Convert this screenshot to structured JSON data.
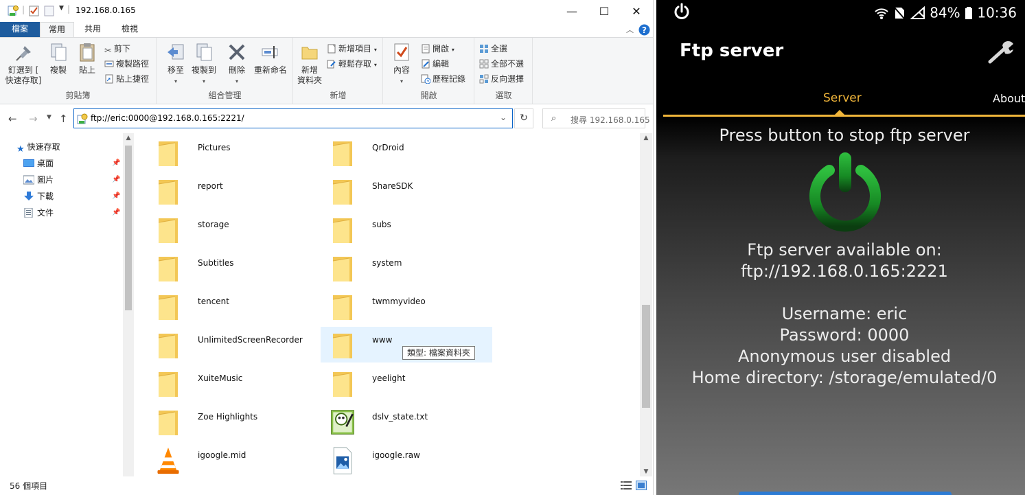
{
  "explorer": {
    "window_title": "192.168.0.165",
    "controls": {
      "minimize": "—",
      "maximize": "☐",
      "close": "✕"
    },
    "tabs": {
      "file": "檔案",
      "home": "常用",
      "share": "共用",
      "view": "檢視"
    },
    "ribbon": {
      "clipboard": {
        "label": "剪貼簿",
        "pin_line1": "釘選到 [",
        "pin_line2": "快速存取]",
        "copy": "複製",
        "paste": "貼上",
        "cut": "剪下",
        "copy_path": "複製路徑",
        "paste_shortcut": "貼上捷徑"
      },
      "organize": {
        "label": "組合管理",
        "move_to": "移至",
        "copy_to": "複製到",
        "delete": "刪除",
        "rename": "重新命名"
      },
      "new": {
        "label": "新增",
        "new_folder_line1": "新增",
        "new_folder_line2": "資料夾",
        "new_item": "新增項目",
        "easy_access": "輕鬆存取"
      },
      "open": {
        "label": "開啟",
        "properties": "內容",
        "open": "開啟",
        "edit": "編輯",
        "history": "歷程記錄"
      },
      "select": {
        "label": "選取",
        "select_all": "全選",
        "select_none": "全部不選",
        "invert": "反向選擇"
      }
    },
    "address": {
      "path": "ftp://eric:0000@192.168.0.165:2221/",
      "search_placeholder": "搜尋 192.168.0.165"
    },
    "nav": {
      "quick_access": "快速存取",
      "items": [
        {
          "label": "桌面"
        },
        {
          "label": "圖片"
        },
        {
          "label": "下載"
        },
        {
          "label": "文件"
        }
      ]
    },
    "files": [
      {
        "name": "Pictures",
        "type": "folder"
      },
      {
        "name": "QrDroid",
        "type": "folder"
      },
      {
        "name": "report",
        "type": "folder"
      },
      {
        "name": "ShareSDK",
        "type": "folder"
      },
      {
        "name": "storage",
        "type": "folder"
      },
      {
        "name": "subs",
        "type": "folder"
      },
      {
        "name": "Subtitles",
        "type": "folder"
      },
      {
        "name": "system",
        "type": "folder"
      },
      {
        "name": "tencent",
        "type": "folder"
      },
      {
        "name": "twmmyvideo",
        "type": "folder"
      },
      {
        "name": "UnlimitedScreenRecorder",
        "type": "folder"
      },
      {
        "name": "www",
        "type": "folder"
      },
      {
        "name": "XuiteMusic",
        "type": "folder"
      },
      {
        "name": "yeelight",
        "type": "folder"
      },
      {
        "name": "Zoe Highlights",
        "type": "folder"
      },
      {
        "name": "dslv_state.txt",
        "type": "text"
      },
      {
        "name": "igoogle.mid",
        "type": "vlc"
      },
      {
        "name": "igoogle.raw",
        "type": "image"
      }
    ],
    "tooltip": "類型: 檔案資料夾",
    "status_count": "56 個項目"
  },
  "phone": {
    "status": {
      "battery": "84%",
      "time": "10:36"
    },
    "app_title": "Ftp server",
    "tabs": {
      "server": "Server",
      "about": "About"
    },
    "prompt": "Press button to stop ftp server",
    "available_label": "Ftp server available on:",
    "url": "ftp://192.168.0.165:2221",
    "username": "Username: eric",
    "password": "Password: 0000",
    "anonymous": "Anonymous user disabled",
    "home_dir": "Home directory: /storage/emulated/0",
    "colors": {
      "accent": "#f0b53a",
      "power_green": "#1f9a2e"
    }
  }
}
